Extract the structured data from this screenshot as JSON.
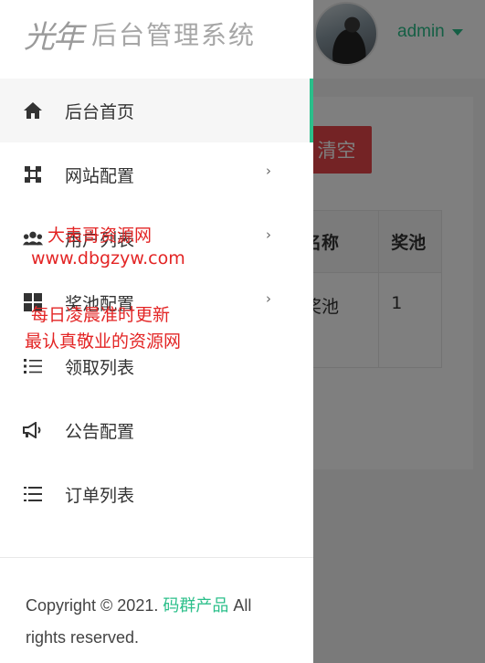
{
  "header": {
    "user_name": "admin"
  },
  "background": {
    "clear_button": "清空",
    "table": {
      "headers": [
        "池名称",
        "奖池"
      ],
      "rows": [
        [
          "式奖池",
          "1"
        ]
      ]
    }
  },
  "sidebar": {
    "logo_mark": "光年",
    "title": "后台管理系统",
    "items": [
      {
        "label": "后台首页",
        "icon": "home-icon",
        "active": true,
        "has_children": false
      },
      {
        "label": "网站配置",
        "icon": "settings-icon",
        "active": false,
        "has_children": true
      },
      {
        "label": "用户列表",
        "icon": "users-icon",
        "active": false,
        "has_children": true
      },
      {
        "label": "奖池配置",
        "icon": "grid-icon",
        "active": false,
        "has_children": true
      },
      {
        "label": "领取列表",
        "icon": "list-icon",
        "active": false,
        "has_children": false
      },
      {
        "label": "公告配置",
        "icon": "megaphone-icon",
        "active": false,
        "has_children": false
      },
      {
        "label": "订单列表",
        "icon": "list-icon",
        "active": false,
        "has_children": false
      }
    ],
    "footer": {
      "prefix": "Copyright © 2021. ",
      "brand": "码群产品",
      "suffix": " All rights reserved."
    }
  },
  "watermark": {
    "line1": "大表哥资源网",
    "line2": "www.dbgzyw.com",
    "line3": "每日凌晨准时更新",
    "line4": "最认真敬业的资源网"
  },
  "colors": {
    "accent": "#2bbf8a",
    "danger": "#e8474b",
    "watermark": "#e32525"
  }
}
